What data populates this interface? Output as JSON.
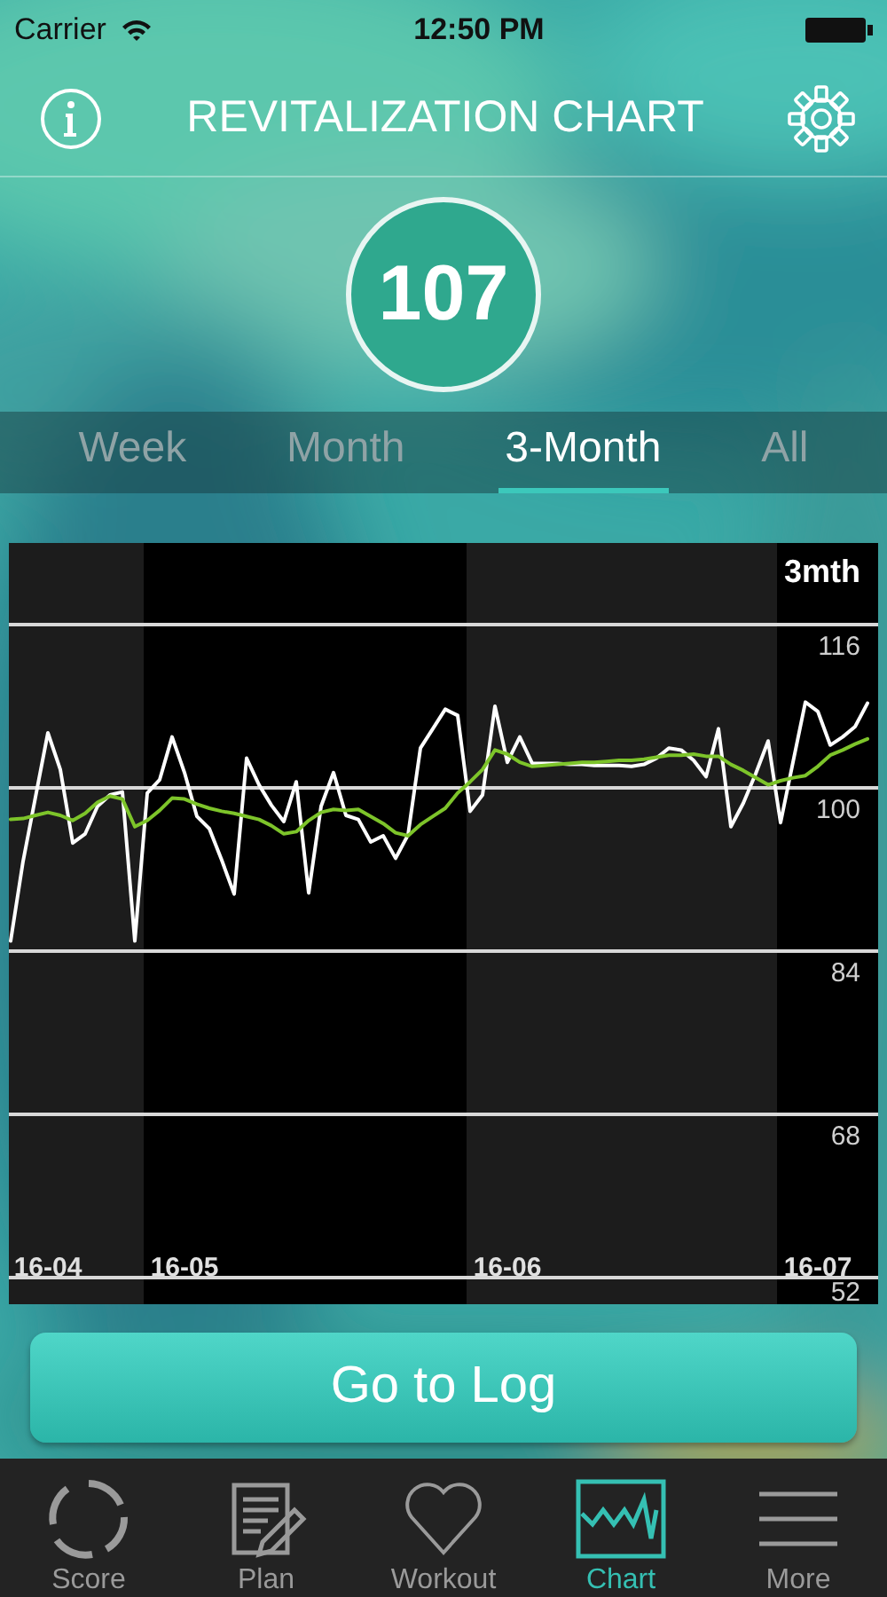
{
  "status_bar": {
    "carrier": "Carrier",
    "time": "12:50 PM"
  },
  "header": {
    "title": "REVITALIZATION CHART"
  },
  "score": "107",
  "periods": [
    {
      "label": "Week",
      "selected": false
    },
    {
      "label": "Month",
      "selected": false
    },
    {
      "label": "3-Month",
      "selected": true
    },
    {
      "label": "All",
      "selected": false
    }
  ],
  "chart_data": {
    "type": "line",
    "title": "3mth",
    "categories": [
      null,
      null,
      null,
      "16-04",
      null,
      null,
      null,
      null,
      null,
      null,
      null,
      null,
      null,
      null,
      "16-05",
      null,
      null,
      null,
      null,
      null,
      null,
      null,
      null,
      null,
      null,
      null,
      null,
      null,
      null,
      null,
      null,
      null,
      null,
      null,
      null,
      null,
      null,
      null,
      null,
      null,
      "16-06",
      null,
      null,
      null,
      null,
      null,
      null,
      null,
      null,
      null,
      null,
      null,
      null,
      null,
      null,
      null,
      null,
      null,
      null,
      null,
      null,
      null,
      null,
      null,
      null,
      "16-07",
      null,
      null,
      null,
      null
    ],
    "series": [
      {
        "color": "#ffffff",
        "values": [
          85.0,
          92.8,
          99.1,
          105.4,
          101.8,
          94.6,
          95.5,
          98.2,
          99.3,
          99.6,
          85.0,
          99.5,
          100.8,
          105.0,
          101.5,
          97.2,
          96.0,
          92.9,
          89.6,
          102.9,
          100.3,
          98.3,
          96.7,
          100.6,
          89.7,
          98.2,
          101.5,
          97.3,
          96.9,
          94.7,
          95.3,
          93.1,
          95.4,
          103.9,
          105.8,
          107.7,
          107.1,
          97.7,
          99.3,
          108.0,
          102.5,
          105.0,
          102.4,
          102.4,
          102.4,
          102.3,
          102.3,
          102.2,
          102.2,
          102.2,
          102.1,
          102.3,
          102.9,
          103.9,
          103.7,
          102.7,
          101.1,
          105.8,
          96.2,
          98.5,
          101.4,
          104.6,
          96.6,
          102.5,
          108.4,
          107.5,
          104.2,
          105.0,
          106.0,
          108.3
        ]
      },
      {
        "color": "#7dc42a",
        "values": [
          96.9,
          97.0,
          97.3,
          97.6,
          97.3,
          96.8,
          97.5,
          98.6,
          99.2,
          98.9,
          96.2,
          96.8,
          97.8,
          99.0,
          98.9,
          98.4,
          98.0,
          97.7,
          97.5,
          97.2,
          96.9,
          96.3,
          95.5,
          95.7,
          96.8,
          97.6,
          97.9,
          97.8,
          97.9,
          97.2,
          96.5,
          95.6,
          95.3,
          96.4,
          97.2,
          98.0,
          99.5,
          100.6,
          101.8,
          103.7,
          103.3,
          102.5,
          102.1,
          102.2,
          102.3,
          102.4,
          102.5,
          102.5,
          102.6,
          102.7,
          102.7,
          102.8,
          103.0,
          103.2,
          103.2,
          103.3,
          103.1,
          103.1,
          102.3,
          101.7,
          101.0,
          100.3,
          100.7,
          101.0,
          101.2,
          102.1,
          103.2,
          103.7,
          104.3,
          104.8
        ]
      }
    ],
    "ylim": [
      49.4,
      124
    ],
    "grid": true,
    "yticks": [
      116,
      100,
      84,
      68,
      52
    ]
  },
  "action_button": "Go to Log",
  "tab_bar": [
    {
      "label": "Score",
      "selected": false
    },
    {
      "label": "Plan",
      "selected": false
    },
    {
      "label": "Workout",
      "selected": false
    },
    {
      "label": "Chart",
      "selected": true
    },
    {
      "label": "More",
      "selected": false
    }
  ]
}
